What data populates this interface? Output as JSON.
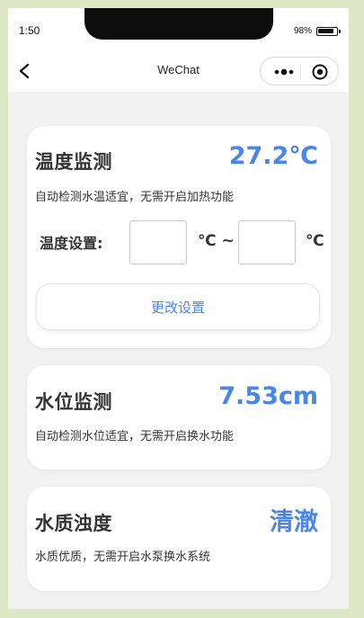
{
  "status_bar": {
    "time": "1:50",
    "battery": "98%"
  },
  "navbar": {
    "title": "WeChat"
  },
  "temperature": {
    "title": "温度监测",
    "value": "27.2℃",
    "description": "自动检测水温适宜，无需开启加热功能",
    "setting_label": "温度设置:",
    "min_value": "",
    "max_value": "",
    "unit_between": "℃ ~",
    "unit_end": "℃",
    "button_label": "更改设置"
  },
  "water_level": {
    "title": "水位监测",
    "value": "7.53cm",
    "description": "自动检测水位适宜，无需开启换水功能"
  },
  "water_quality": {
    "title": "水质浊度",
    "value": "清澈",
    "description": "水质优质，无需开启水泵换水系统"
  },
  "colors": {
    "accent": "#4a86e8",
    "page_bg": "#f2f2f2",
    "frame_bg": "#dfe8c6"
  },
  "icons": {
    "back": "back-arrow-icon",
    "more": "more-dots-icon",
    "close": "close-circle-icon"
  }
}
